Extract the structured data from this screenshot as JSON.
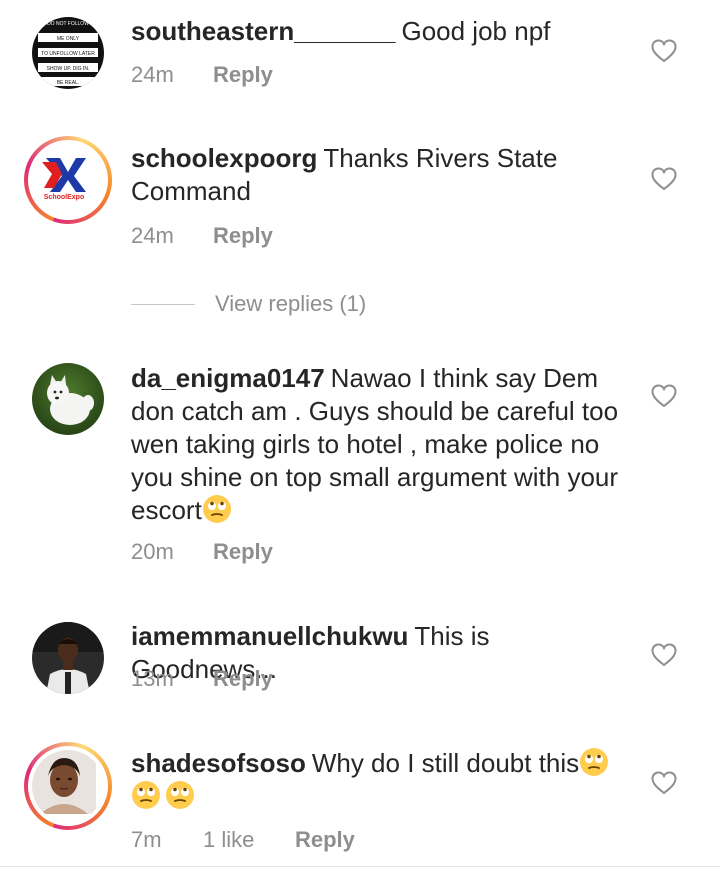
{
  "comments": [
    {
      "username": "southeastern_______",
      "text": "Good job npf",
      "time": "24m",
      "likes": "",
      "reply": "Reply",
      "avatar_text": [
        "DO NOT FOLLOW",
        "ME ONLY",
        "TO UNFOLLOW LATER",
        "SHOW UP. DIG IN.",
        "BE REAL."
      ]
    },
    {
      "username": "schoolexpoorg",
      "text": "Thanks Rivers State Command",
      "time": "24m",
      "likes": "",
      "reply": "Reply",
      "avatar_text": [
        "SchoolExpo"
      ]
    },
    {
      "username": "da_enigma0147",
      "text": "Nawao I think say Dem don catch am . Guys should be careful too wen taking girls to hotel , make police no you shine on top small argument with your escort",
      "time": "20m",
      "likes": "",
      "reply": "Reply"
    },
    {
      "username": "iamemmanuellchukwu",
      "text": "This is Goodnews...",
      "time": "13m",
      "likes": "",
      "reply": "Reply"
    },
    {
      "username": "shadesofsoso",
      "text": "Why do I still doubt this",
      "time": "7m",
      "likes": "1 like",
      "reply": "Reply"
    }
  ],
  "view_replies": "View replies (1)",
  "icons": {
    "heart": "heart-outline-icon",
    "emoji": "face-with-rolling-eyes-emoji"
  },
  "colors": {
    "text": "#262626",
    "meta": "#8e8e8e",
    "heart": "#8e8e8e"
  }
}
